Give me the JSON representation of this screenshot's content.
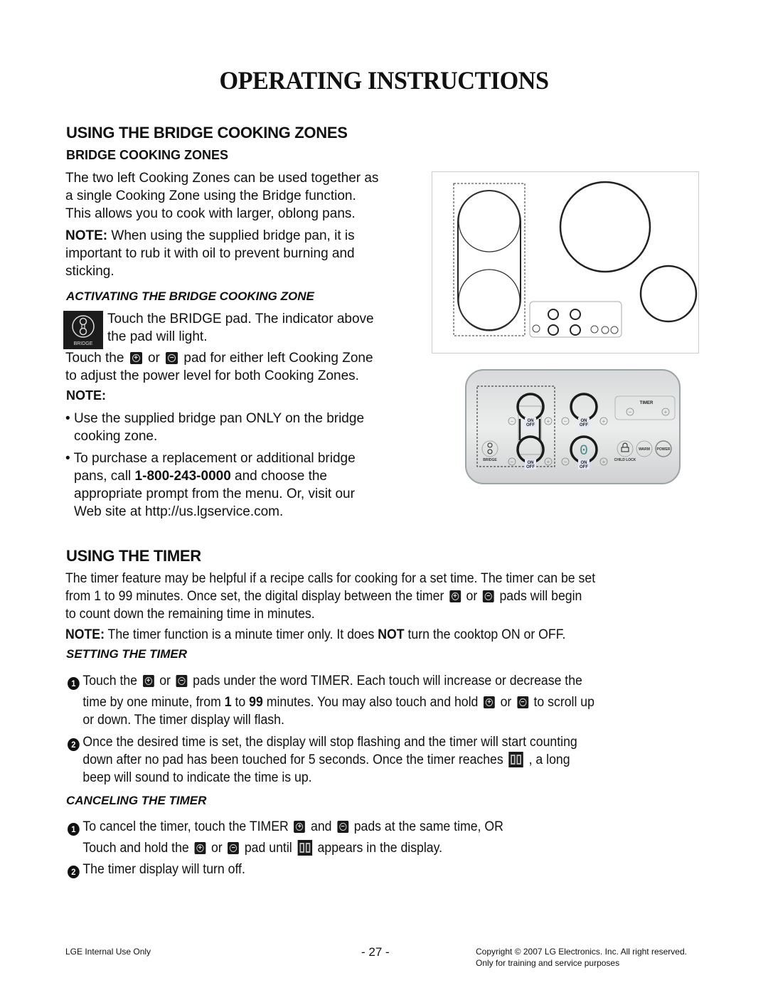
{
  "page_title": "OPERATING INSTRUCTIONS",
  "bridge_section": {
    "heading": "USING THE BRIDGE COOKING ZONES",
    "subheading": "BRIDGE COOKING ZONES",
    "intro_lines": [
      "The two left Cooking Zones can be used together as",
      "a single Cooking Zone using the Bridge function.",
      "This allows you to cook with larger, oblong pans."
    ],
    "note_label": "NOTE:",
    "note_lines": [
      " When using the supplied bridge pan, it is",
      "important to rub it with oil to prevent burning and",
      "sticking."
    ],
    "activating_heading": "ACTIVATING THE BRIDGE COOKING ZONE",
    "bridge_icon_label": "BRIDGE",
    "activating_lines": [
      "Touch the BRIDGE pad. The indicator above",
      "the pad will light."
    ],
    "adjust_line1_parts": [
      "Touch the ",
      " or ",
      " pad for either left Cooking Zone"
    ],
    "adjust_line2": "to adjust the power level for both Cooking Zones.",
    "note2_label": "NOTE:",
    "bullets": [
      {
        "lines": [
          "Use the supplied bridge pan ONLY on the bridge",
          "cooking zone."
        ]
      },
      {
        "pre": "To purchase a replacement or additional bridge",
        "line2_pre": "pans, call ",
        "phone": "1-800-243-0000",
        "line2_post": " and choose the",
        "lines_after": [
          "appropriate prompt from the menu. Or, visit our",
          "Web site at http://us.lgservice.com."
        ]
      }
    ]
  },
  "cooktop_panel": {
    "on_label": "ON",
    "off_label": "OFF",
    "timer_label": "TIMER",
    "bridge_label": "BRIDGE",
    "child_lock_label": "CHILD LOCK",
    "warm_label": "WARM",
    "power_label": "POWER",
    "display_digit": "0",
    "minus": "−",
    "plus": "+"
  },
  "timer_section": {
    "heading": "USING THE TIMER",
    "intro_line1": "The timer feature may be helpful if a recipe calls for cooking for a set time. The timer can be set",
    "intro_line2_parts": [
      "from 1 to 99 minutes. Once set, the digital display between the timer ",
      " or ",
      " pads will begin"
    ],
    "intro_line3": "to count down the remaining time in minutes.",
    "note_label": "NOTE:",
    "note_pre": " The timer function is a minute timer only. It does ",
    "note_bold": "NOT",
    "note_post": " turn the cooktop ON or OFF.",
    "setting_heading": "SETTING THE TIMER",
    "step1_num": "1",
    "step1_line1_parts": [
      "Touch the ",
      " or ",
      " pads under the word TIMER. Each touch will increase or decrease the"
    ],
    "step1_line2_parts": [
      "time by one minute, from ",
      "1",
      " to ",
      "99",
      " minutes. You may also touch and hold ",
      " or ",
      " to scroll up"
    ],
    "step1_line3": "or down. The timer display will flash.",
    "step2_num": "2",
    "step2_line1": "Once the desired time is set, the display will stop flashing and the timer will start counting",
    "step2_line2_parts": [
      "down after no pad has been touched for 5 seconds. Once the timer reaches ",
      " , a long"
    ],
    "step2_line3": "beep will sound to indicate the time is up.",
    "canceling_heading": "CANCELING THE TIMER",
    "cancel1_num": "1",
    "cancel1_line1_parts": [
      "To cancel the timer, touch the TIMER ",
      " and ",
      " pads at the same time, OR"
    ],
    "cancel1_line2_parts": [
      "Touch and hold the ",
      " or ",
      " pad until ",
      " appears in the display."
    ],
    "cancel2_num": "2",
    "cancel2_line": "The timer display will turn off."
  },
  "footer": {
    "left": "LGE Internal Use Only",
    "page": "- 27 -",
    "copyright": "Copyright © 2007 LG Electronics. Inc. All right reserved.",
    "purpose": "Only for training and service purposes"
  }
}
